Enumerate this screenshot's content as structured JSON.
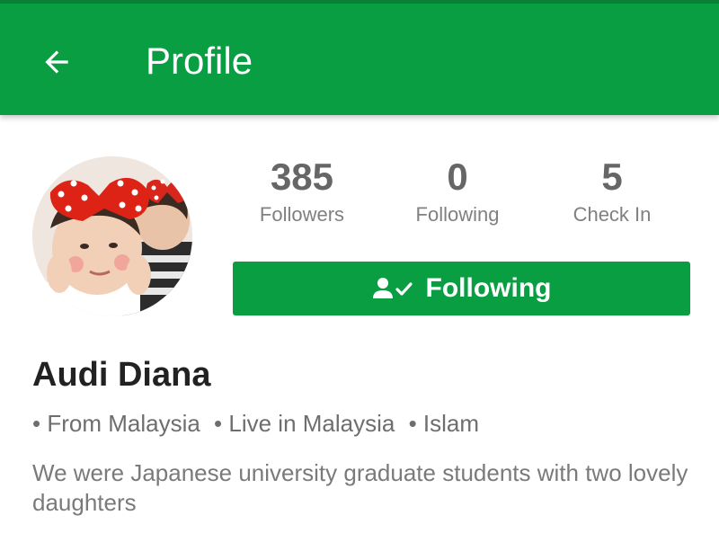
{
  "header": {
    "title": "Profile",
    "back_icon": "arrow-left-icon",
    "bar_color": "#0a9e43"
  },
  "profile": {
    "name": "Audi Diana",
    "tags": [
      "• From Malaysia",
      "• Live in Malaysia",
      "• Islam"
    ],
    "bio": "We were Japanese university graduate students with two lovely daughters"
  },
  "stats": [
    {
      "value": "385",
      "label": "Followers"
    },
    {
      "value": "0",
      "label": "Following"
    },
    {
      "value": "5",
      "label": "Check In"
    }
  ],
  "follow_button": {
    "label": "Following",
    "icon": "person-check-icon",
    "color": "#0a9e43"
  }
}
